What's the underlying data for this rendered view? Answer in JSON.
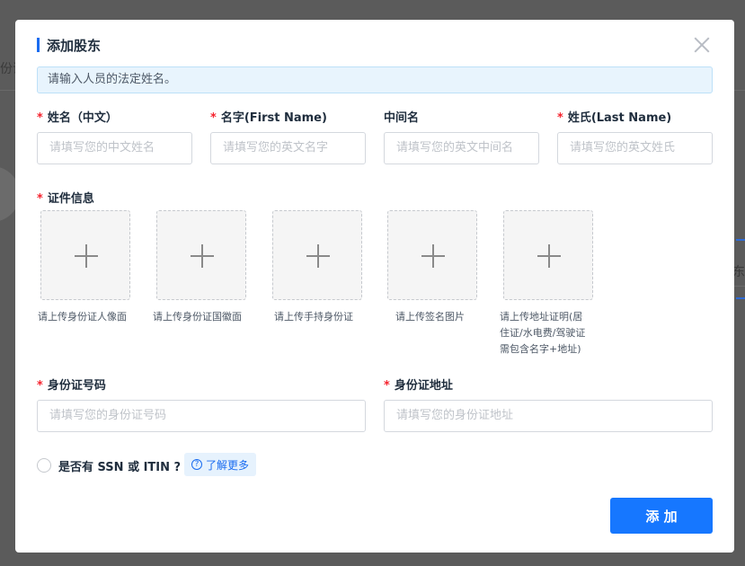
{
  "background": {
    "frag_left_top": "份证",
    "frag_right_mid": "东"
  },
  "dialog": {
    "title": "添加股东",
    "notice": "请输入人员的法定姓名。"
  },
  "fields": {
    "name_cn": {
      "label": "姓名（中文）",
      "required": "*",
      "placeholder": "请填写您的中文姓名"
    },
    "first_name": {
      "label": "名字(First Name)",
      "required": "*",
      "placeholder": "请填写您的英文名字"
    },
    "middle_name": {
      "label": "中间名",
      "placeholder": "请填写您的英文中间名"
    },
    "last_name": {
      "label": "姓氏(Last Name)",
      "required": "*",
      "placeholder": "请填写您的英文姓氏"
    },
    "id_info": {
      "label": "证件信息",
      "required": "*"
    },
    "id_number": {
      "label": "身份证号码",
      "required": "*",
      "placeholder": "请填写您的身份证号码"
    },
    "id_address": {
      "label": "身份证地址",
      "required": "*",
      "placeholder": "请填写您的身份证地址"
    }
  },
  "uploads": [
    {
      "caption": "请上传身份证人像面"
    },
    {
      "caption": "请上传身份证国徽面"
    },
    {
      "caption": "请上传手持身份证"
    },
    {
      "caption": "请上传签名图片"
    },
    {
      "caption_lines": [
        "请上传地址证明(居",
        "住证/水电费/驾驶证",
        "需包含名字+地址)"
      ]
    }
  ],
  "ssn": {
    "question": "是否有 SSN 或 ITIN ?",
    "learn_more": "了解更多",
    "help_icon_glyph": "?"
  },
  "actions": {
    "add": "添 加"
  },
  "colors": {
    "primary": "#1677ff",
    "required": "#f5222d",
    "notice_bg": "#e8f4fd"
  }
}
